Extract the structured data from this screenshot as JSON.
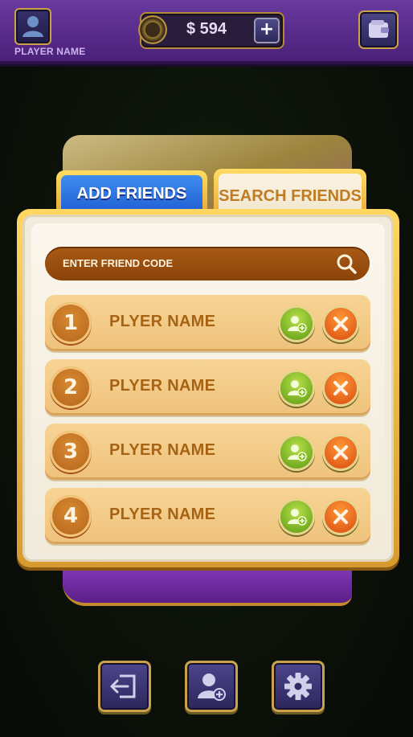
{
  "header": {
    "player_name": "PLAYER NAME",
    "coins": "$ 594",
    "add_coins_label": "+",
    "icons": [
      "avatar-icon",
      "coin-icon",
      "plus-icon",
      "wallet-icon"
    ]
  },
  "tabs": {
    "add_friends": "ADD FRIENDS",
    "search_friends": "SEARCH FRIENDS",
    "active": "search_friends"
  },
  "search": {
    "placeholder": "ENTER FRIEND CODE"
  },
  "requests": [
    {
      "rank": "1",
      "name": "PLYER NAME"
    },
    {
      "rank": "2",
      "name": "PLYER NAME"
    },
    {
      "rank": "3",
      "name": "PLYER NAME"
    },
    {
      "rank": "4",
      "name": "PLYER NAME"
    }
  ],
  "bottom_nav": [
    "exit-icon",
    "add-friend-icon",
    "settings-icon"
  ],
  "colors": {
    "topbar": "#5a2d8c",
    "panel_gold": "#f2bf45",
    "tab_blue": "#2f74e6",
    "accent_orange": "#c07c22",
    "accept_green": "#7dbb1e",
    "decline_orange": "#e8581a"
  }
}
